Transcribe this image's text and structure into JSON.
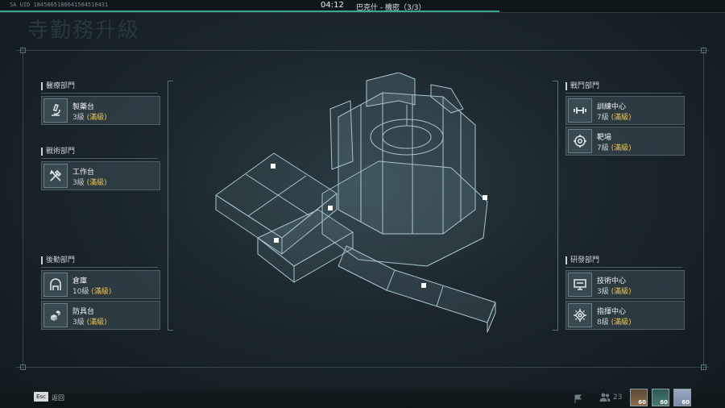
{
  "top_bar": {
    "uid": "SA UID 1845865188641504516431",
    "timer": "04:12",
    "mission": "巴克什 - 機密（3/3）"
  },
  "background_title": "寺勤務升級",
  "groups": {
    "medical": {
      "label": "醫療部門",
      "cards": [
        {
          "name": "製藥台",
          "level": "3級",
          "max": "(滿級)",
          "icon": "microscope-icon"
        }
      ]
    },
    "tactical": {
      "label": "戰術部門",
      "cards": [
        {
          "name": "工作台",
          "level": "3級",
          "max": "(滿級)",
          "icon": "tools-icon"
        }
      ]
    },
    "logistics": {
      "label": "後勤部門",
      "cards": [
        {
          "name": "倉庫",
          "level": "10級",
          "max": "(滿級)",
          "icon": "warehouse-icon"
        },
        {
          "name": "防具台",
          "level": "3級",
          "max": "(滿級)",
          "icon": "armor-crates-icon"
        }
      ]
    },
    "combat": {
      "label": "戰鬥部門",
      "cards": [
        {
          "name": "訓練中心",
          "level": "7級",
          "max": "(滿級)",
          "icon": "dumbbell-icon"
        },
        {
          "name": "靶場",
          "level": "7級",
          "max": "(滿級)",
          "icon": "target-icon"
        }
      ]
    },
    "research": {
      "label": "研發部門",
      "cards": [
        {
          "name": "技術中心",
          "level": "3級",
          "max": "(滿級)",
          "icon": "monitor-icon"
        },
        {
          "name": "指揮中心",
          "level": "8級",
          "max": "(滿級)",
          "icon": "chip-icon"
        }
      ]
    }
  },
  "bottom_bar": {
    "esc_key": "Esc",
    "back_label": "返回",
    "player_count": "23",
    "avatars": [
      {
        "level": "60",
        "color": "#8a6a4a"
      },
      {
        "level": "60",
        "color": "#4a7a70"
      },
      {
        "level": "60",
        "color": "#7a8aa8"
      }
    ]
  },
  "colors": {
    "accent_progress": "#3fa58c",
    "max_level": "#e8c15a"
  }
}
